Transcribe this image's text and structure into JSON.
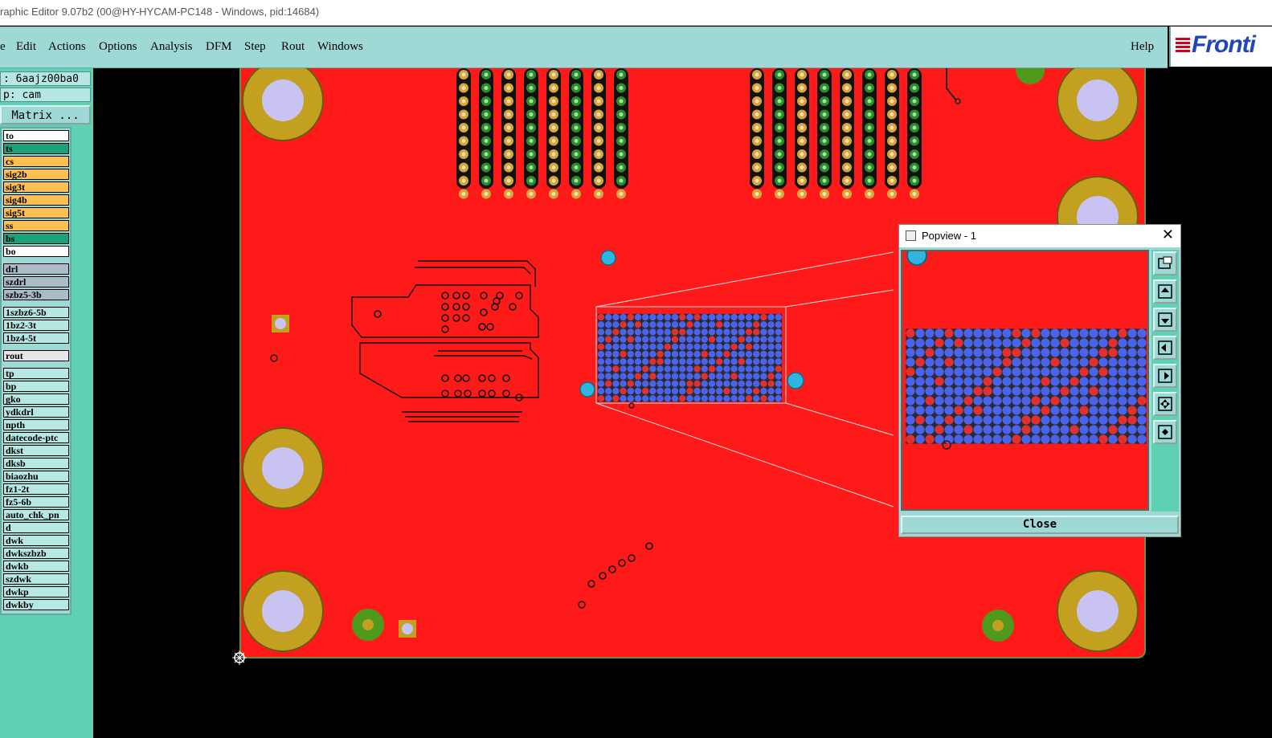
{
  "window": {
    "title": "raphic Editor 9.07b2 (00@HY-HYCAM-PC148 - Windows, pid:14684)"
  },
  "menubar": {
    "items": [
      "e",
      "Edit",
      "Actions",
      "Options",
      "Analysis",
      "DFM",
      "Step",
      "Rout",
      "Windows"
    ],
    "help": "Help"
  },
  "logo": {
    "text": "Fronti"
  },
  "info": {
    "job": ": 6aajz00ba0",
    "step": "p: cam",
    "matrix_button": "Matrix ..."
  },
  "layers": [
    {
      "name": "to",
      "color": "#ffffff"
    },
    {
      "name": "ts",
      "color": "#1aa37a"
    },
    {
      "name": "cs",
      "color": "#ffc04d"
    },
    {
      "name": "sig2b",
      "color": "#ffc04d"
    },
    {
      "name": "sig3t",
      "color": "#ffc04d"
    },
    {
      "name": "sig4b",
      "color": "#ffc04d"
    },
    {
      "name": "sig5t",
      "color": "#ffc04d"
    },
    {
      "name": "ss",
      "color": "#ffc04d"
    },
    {
      "name": "bs",
      "color": "#1aa37a"
    },
    {
      "name": "bo",
      "color": "#ffffff"
    },
    {
      "name": "drl",
      "color": "#a9bcc8"
    },
    {
      "name": "szdrl",
      "color": "#a9bcc8"
    },
    {
      "name": "szbz5-3b",
      "color": "#a9bcc8"
    },
    {
      "name": "1szbz6-5b",
      "color": "#b6e7e3"
    },
    {
      "name": "1bz2-3t",
      "color": "#b6e7e3"
    },
    {
      "name": "1bz4-5t",
      "color": "#b6e7e3"
    },
    {
      "name": "rout",
      "color": "#e6e6e6"
    },
    {
      "name": "tp",
      "color": "#b6e7e3"
    },
    {
      "name": "bp",
      "color": "#b6e7e3"
    },
    {
      "name": "gko",
      "color": "#b6e7e3"
    },
    {
      "name": "ydkdrl",
      "color": "#b6e7e3"
    },
    {
      "name": "npth",
      "color": "#b6e7e3"
    },
    {
      "name": "datecode-ptc",
      "color": "#b6e7e3"
    },
    {
      "name": "dkst",
      "color": "#b6e7e3"
    },
    {
      "name": "dksb",
      "color": "#b6e7e3"
    },
    {
      "name": "biaozhu",
      "color": "#b6e7e3"
    },
    {
      "name": "fz1-2t",
      "color": "#b6e7e3"
    },
    {
      "name": "fz5-6b",
      "color": "#b6e7e3"
    },
    {
      "name": "auto_chk_pn",
      "color": "#b6e7e3"
    },
    {
      "name": "d",
      "color": "#b6e7e3"
    },
    {
      "name": "dwk",
      "color": "#b6e7e3"
    },
    {
      "name": "dwkszbzb",
      "color": "#b6e7e3"
    },
    {
      "name": "dwkb",
      "color": "#b6e7e3"
    },
    {
      "name": "szdwk",
      "color": "#b6e7e3"
    },
    {
      "name": "dwkp",
      "color": "#b6e7e3"
    },
    {
      "name": "dwkby",
      "color": "#b6e7e3"
    }
  ],
  "popview": {
    "title": "Popview - 1",
    "close_label": "Close"
  },
  "colors": {
    "board": "#ff1a1a",
    "pad_gold": "#c3a01f",
    "hole_lavender": "#c8c3f2",
    "bga_blue": "#4a63e8",
    "via_cyan": "#2fb5e0"
  }
}
